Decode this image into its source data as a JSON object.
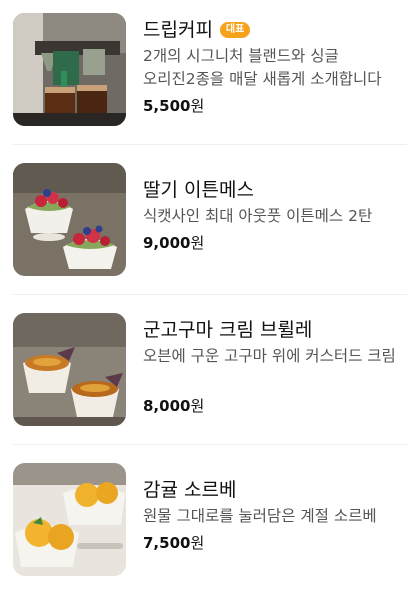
{
  "menu": {
    "items": [
      {
        "title": "드립커피",
        "badge": "대표",
        "description": "2개의 시그니처 블랜드와 싱글 오리진2종을 매달 새롭게 소개합니다",
        "price_value": "5,500",
        "price_unit": "원",
        "image": "drip-coffee-photo"
      },
      {
        "title": "딸기 이튼메스",
        "description": "식캣사인 최대 아웃풋 이튼메스 2탄",
        "price_value": "9,000",
        "price_unit": "원",
        "image": "strawberry-eton-mess-photo"
      },
      {
        "title": "군고구마 크림 브륄레",
        "description": "오븐에 구운 고구마 위에 커스터드 크림",
        "price_value": "8,000",
        "price_unit": "원",
        "image": "sweet-potato-creme-brulee-photo"
      },
      {
        "title": "감귤 소르베",
        "description": "원물 그대로를 눌러담은 계절 소르베",
        "price_value": "7,500",
        "price_unit": "원",
        "image": "tangerine-sorbet-photo"
      }
    ]
  },
  "colors": {
    "badge": "#f7a21b",
    "divider": "#eeeeee",
    "title": "#111111",
    "description": "#555555"
  }
}
